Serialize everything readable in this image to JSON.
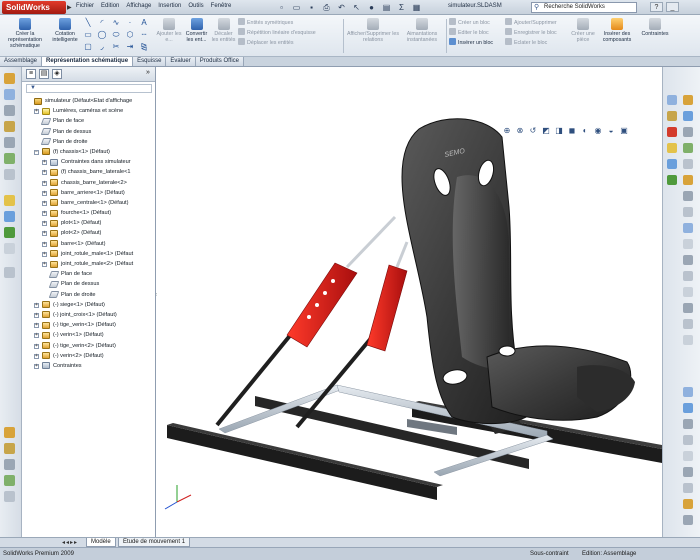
{
  "app": {
    "logo": "SolidWorks",
    "menus": [
      "Fichier",
      "Edition",
      "Affichage",
      "Insertion",
      "Outils",
      "Fenêtre"
    ],
    "doc_title": "simulateur.SLDASM",
    "search_placeholder": "Recherche SolidWorks"
  },
  "ribbon": {
    "create_drawing": "Créer la représentation schématique",
    "smart_dim": "Cotation intelligente",
    "relations": [
      "Ajouter les e...",
      "Convertir les ent...",
      "Décaler les entités"
    ],
    "list1": [
      "Entités symétriques",
      "Répétition linéaire d'esquisse",
      "Déplacer les entités"
    ],
    "show_relations": "Afficher/Supprimer les relations",
    "snap": "Aimantations instantanées",
    "blocks": [
      "Créer un bloc",
      "Editer le bloc",
      "Insérer un bloc"
    ],
    "blocks2": [
      "Ajouter/Supprimer",
      "Enregistrer le bloc",
      "Eclater le bloc"
    ],
    "create_part": "Créer une pièce",
    "insert_components": "Insérer des composants",
    "constraints": "Contraintes"
  },
  "tabs": [
    "Assemblage",
    "Représentation schématique",
    "Esquisse",
    "Evaluer",
    "Produits Office"
  ],
  "tree": [
    {
      "t": "simulateur  (Défaut<Etat d'affichage",
      "lvl": 0,
      "ico": "asm",
      "exp": ""
    },
    {
      "t": "Lumières, caméras et scène",
      "lvl": 1,
      "ico": "light",
      "exp": "+"
    },
    {
      "t": "Plan de face",
      "lvl": 1,
      "ico": "plane",
      "exp": ""
    },
    {
      "t": "Plan de dessus",
      "lvl": 1,
      "ico": "plane",
      "exp": ""
    },
    {
      "t": "Plan de droite",
      "lvl": 1,
      "ico": "plane",
      "exp": ""
    },
    {
      "t": "(f) chassis<1> (Défaut)",
      "lvl": 1,
      "ico": "asm",
      "exp": "−"
    },
    {
      "t": "Contraintes dans simulateur",
      "lvl": 2,
      "ico": "mate",
      "exp": "+"
    },
    {
      "t": "(f) chassis_barre_laterale<1",
      "lvl": 2,
      "ico": "part",
      "exp": "+"
    },
    {
      "t": "chassis_barre_laterale<2>",
      "lvl": 2,
      "ico": "part",
      "exp": "+"
    },
    {
      "t": "barre_arriere<1> (Défaut)",
      "lvl": 2,
      "ico": "part",
      "exp": "+"
    },
    {
      "t": "barre_centrale<1> (Défaut)",
      "lvl": 2,
      "ico": "part",
      "exp": "+"
    },
    {
      "t": "fourche<1> (Défaut)",
      "lvl": 2,
      "ico": "part",
      "exp": "+"
    },
    {
      "t": "plot<1> (Défaut)",
      "lvl": 2,
      "ico": "part",
      "exp": "+"
    },
    {
      "t": "plot<2> (Défaut)",
      "lvl": 2,
      "ico": "part",
      "exp": "+"
    },
    {
      "t": "barre<1> (Défaut)",
      "lvl": 2,
      "ico": "part",
      "exp": "+"
    },
    {
      "t": "joint_rotule_male<1> (Défaut",
      "lvl": 2,
      "ico": "part",
      "exp": "+"
    },
    {
      "t": "joint_rotule_male<2> (Défaut",
      "lvl": 2,
      "ico": "part",
      "exp": "+"
    },
    {
      "t": "Plan de face",
      "lvl": 2,
      "ico": "plane",
      "exp": ""
    },
    {
      "t": "Plan de dessus",
      "lvl": 2,
      "ico": "plane",
      "exp": ""
    },
    {
      "t": "Plan de droite",
      "lvl": 2,
      "ico": "plane",
      "exp": ""
    },
    {
      "t": "(-) siege<1> (Défaut)",
      "lvl": 1,
      "ico": "part",
      "exp": "+"
    },
    {
      "t": "(-) joint_croix<1> (Défaut)",
      "lvl": 1,
      "ico": "part",
      "exp": "+"
    },
    {
      "t": "(-) tige_verin<1> (Défaut)",
      "lvl": 1,
      "ico": "part",
      "exp": "+"
    },
    {
      "t": "(-) verin<1> (Défaut)",
      "lvl": 1,
      "ico": "part",
      "exp": "+"
    },
    {
      "t": "(-) tige_verin<2> (Défaut)",
      "lvl": 1,
      "ico": "part",
      "exp": "+"
    },
    {
      "t": "(-) verin<2> (Défaut)",
      "lvl": 1,
      "ico": "part",
      "exp": "+"
    },
    {
      "t": "Contraintes",
      "lvl": 1,
      "ico": "mate",
      "exp": "+"
    }
  ],
  "bottom_tabs": [
    "Modèle",
    "Etude de mouvement 1"
  ],
  "status": {
    "version": "SolidWorks Premium 2009",
    "state": "Sous-contraint",
    "mode": "Edition: Assemblage"
  },
  "model": {
    "seat_logo": "SEMO"
  },
  "colors": {
    "seat": "#3a3a3a",
    "actuator": "#d0161a",
    "frame": "#1c1c1c",
    "rail": "#c8d0d8"
  }
}
